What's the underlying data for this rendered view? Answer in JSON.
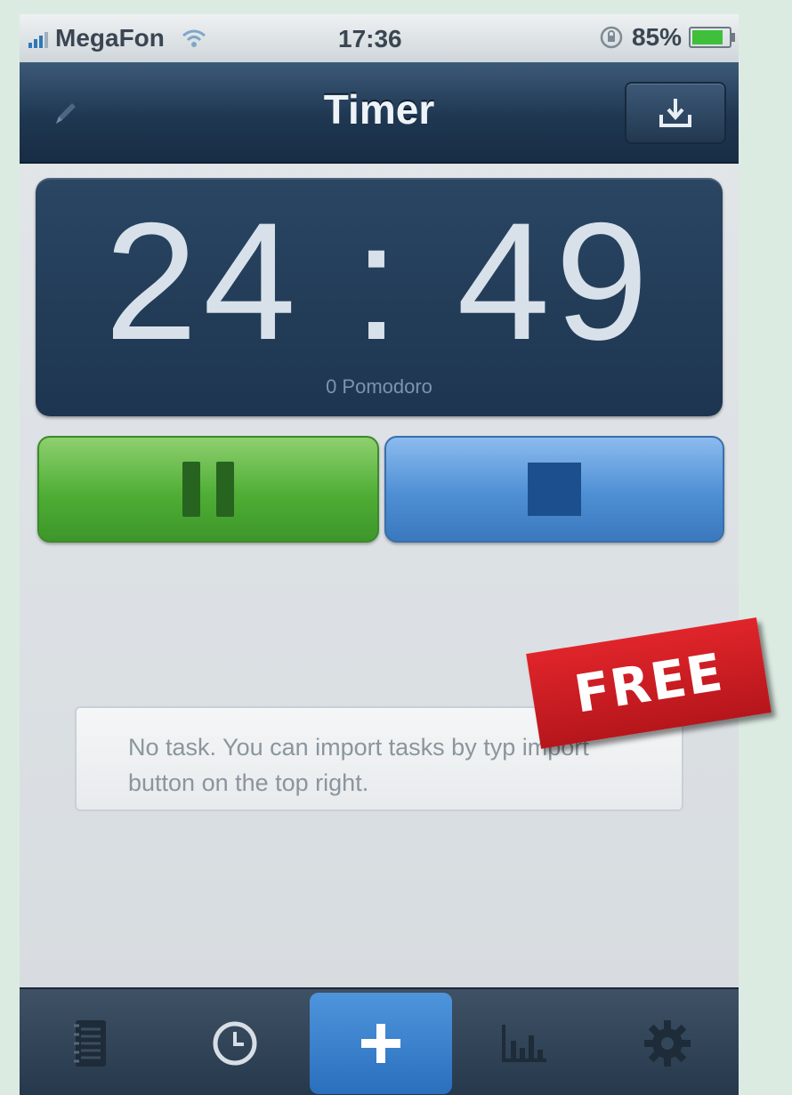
{
  "status_bar": {
    "carrier": "MegaFon",
    "time": "17:36",
    "battery": "85%",
    "battery_level": 0.85
  },
  "nav": {
    "title": "Timer",
    "edit_icon": "pencil-icon",
    "import_icon": "import-tray-icon"
  },
  "timer": {
    "time": "24 : 49",
    "pomodoro_count": "0 Pomodoro"
  },
  "controls": {
    "pause_icon": "pause-icon",
    "stop_icon": "stop-icon"
  },
  "tasks": {
    "empty_message": "No task. You can import tasks by typ import button on the top right."
  },
  "badge": {
    "label": "FREE"
  },
  "tab_bar": {
    "items": [
      {
        "icon": "notebook-icon"
      },
      {
        "icon": "clock-icon"
      },
      {
        "icon": "plus-icon",
        "selected": true
      },
      {
        "icon": "bar-chart-icon"
      },
      {
        "icon": "gear-icon"
      }
    ]
  },
  "colors": {
    "nav": "#1f3751",
    "pause_green": "#4fae35",
    "stop_blue": "#4e8fd4",
    "badge_red": "#cc1c22",
    "tab_active": "#3a82cf"
  }
}
